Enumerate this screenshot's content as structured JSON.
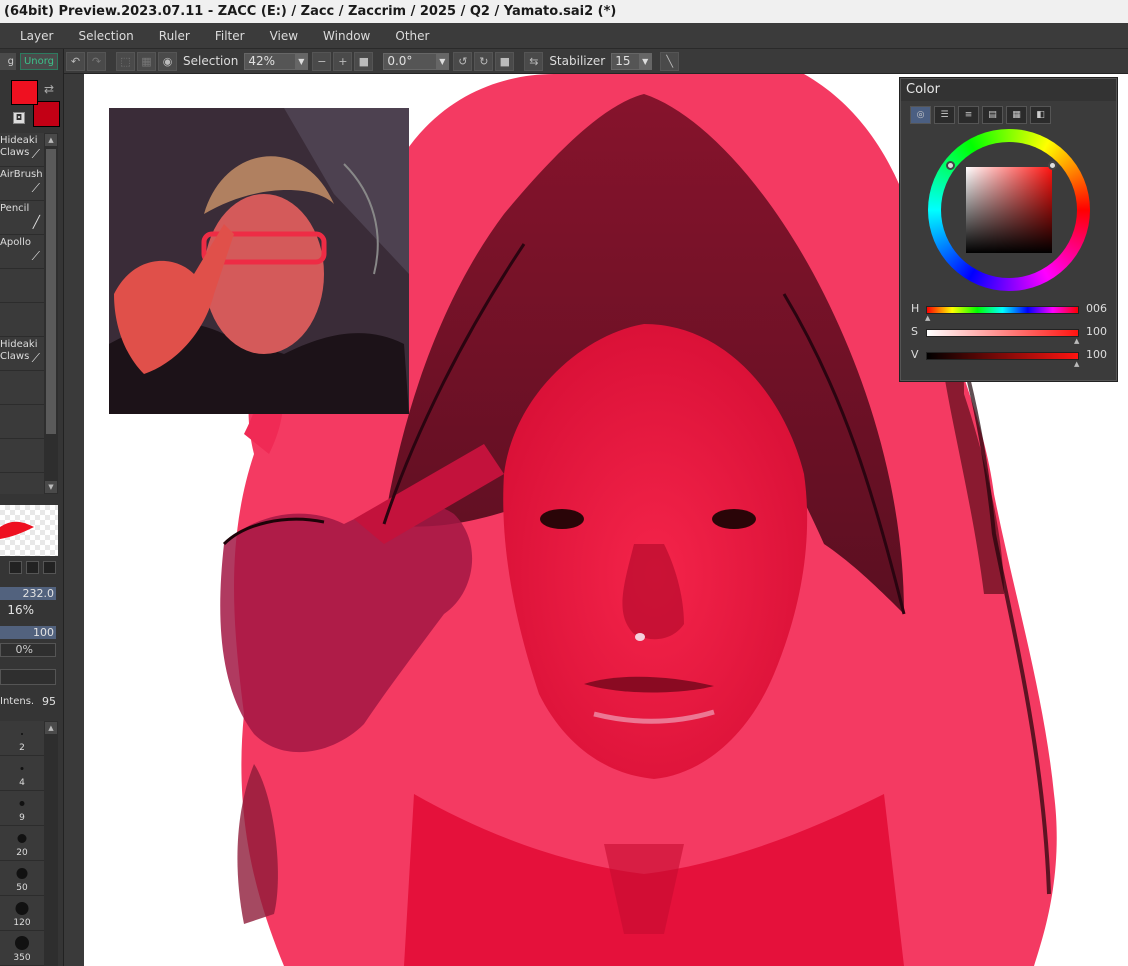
{
  "window": {
    "title": "(64bit) Preview.2023.07.11 - ZACC (E:) / Zacc / Zaccrim / 2025 / Q2 / Yamato.sai2 (*)"
  },
  "menu": [
    "Layer",
    "Selection",
    "Ruler",
    "Filter",
    "View",
    "Window",
    "Other"
  ],
  "toolbar": {
    "selection_label": "Selection",
    "zoom": "42%",
    "rotation": "0.0°",
    "stabilizer_label": "Stabilizer",
    "stabilizer_value": "15"
  },
  "left_panel": {
    "tab_left": "g",
    "tab_right": "Unorg",
    "colors": {
      "primary": "#ef1020",
      "secondary": "#c30015"
    },
    "tools": [
      {
        "label": "Hideaki Claws"
      },
      {
        "label": "AirBrush"
      },
      {
        "label": "Pencil"
      },
      {
        "label": "Apollo"
      },
      {
        "label": ""
      },
      {
        "label": "Hideaki Claws"
      },
      {
        "label": ""
      },
      {
        "label": ""
      },
      {
        "label": ""
      },
      {
        "label": ""
      }
    ],
    "params": {
      "size": "232.0",
      "min_size": "16%",
      "density": "100",
      "min_density": "0%",
      "intensity_label": "Intens.",
      "intensity": "95"
    },
    "brush_sizes": [
      "2",
      "4",
      "9",
      "20",
      "50",
      "120",
      "350"
    ]
  },
  "color_panel": {
    "title": "Color",
    "tabs": [
      "wheel-icon",
      "slider-icon",
      "rgb-icon",
      "list-icon",
      "swatch-icon",
      "scratch-icon"
    ],
    "sliders": [
      {
        "label": "H",
        "value": "006"
      },
      {
        "label": "S",
        "value": "100"
      },
      {
        "label": "V",
        "value": "100"
      }
    ]
  }
}
